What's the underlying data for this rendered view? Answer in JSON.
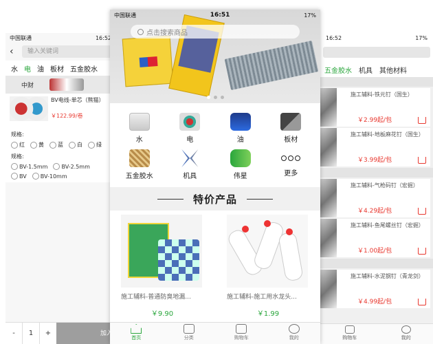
{
  "left": {
    "status": {
      "carrier": "中国联通",
      "time": "16:52"
    },
    "search_placeholder": "输入关键词",
    "categories": [
      "水",
      "电",
      "油",
      "板材",
      "五金胶水"
    ],
    "subcategory": "中财",
    "product": {
      "name": "BV电线-单芯（熊猫）",
      "price": "￥122.99/卷"
    },
    "spec_label": "规格:",
    "colors": [
      "红",
      "黄",
      "蓝",
      "白",
      "绿"
    ],
    "size_label": "规格:",
    "sizes": [
      "BV-1.5mm",
      "BV-2.5mm",
      "BV",
      "BV-10mm"
    ],
    "qty": {
      "minus": "-",
      "value": "1",
      "plus": "+"
    },
    "add_cart": "加入"
  },
  "center": {
    "status": {
      "carrier": "中国联通",
      "time": "16:51",
      "battery": "17%"
    },
    "search_placeholder": "点击搜索商品",
    "grid": [
      {
        "label": "水",
        "icon": "water-pipe-icon"
      },
      {
        "label": "电",
        "icon": "electric-wire-icon"
      },
      {
        "label": "油",
        "icon": "paint-bucket-icon"
      },
      {
        "label": "板材",
        "icon": "board-icon"
      },
      {
        "label": "五金胶水",
        "icon": "hardware-glue-icon"
      },
      {
        "label": "机具",
        "icon": "pliers-icon"
      },
      {
        "label": "伟星",
        "icon": "weixing-pipe-icon"
      },
      {
        "label": "更多",
        "icon": "more-icon"
      }
    ],
    "section_title": "特价产品",
    "products": [
      {
        "name": "施工辅料-普通防臭地漏...",
        "price": "￥9.90"
      },
      {
        "name": "施工辅料-施工用水龙头...",
        "price": "￥1.99"
      }
    ],
    "tabs": [
      "首页",
      "分类",
      "购物车",
      "我的"
    ]
  },
  "right": {
    "status": {
      "time": "16:52",
      "battery": "17%"
    },
    "categories": [
      "五金胶水",
      "机具",
      "其他材料"
    ],
    "items": [
      {
        "name": "施工辅料-铁元钉（国生）",
        "price": "￥2.99起/包"
      },
      {
        "name": "施工辅料-地板麻花钉（国生）",
        "price": "￥3.99起/包"
      },
      {
        "name": "施工辅料-气枪码钉（宏掘）",
        "price": "￥4.29起/包"
      },
      {
        "name": "施工辅料-鱼尾螺丝钉（宏掘）",
        "price": "￥1.00起/包"
      },
      {
        "name": "施工辅料-水泥钢钉（青龙剑）",
        "price": "￥4.99起/包"
      }
    ],
    "tabs": [
      "购物车",
      "我的"
    ]
  },
  "colors": {
    "accent_green": "#2aa63c",
    "price_red": "#e8382f"
  }
}
